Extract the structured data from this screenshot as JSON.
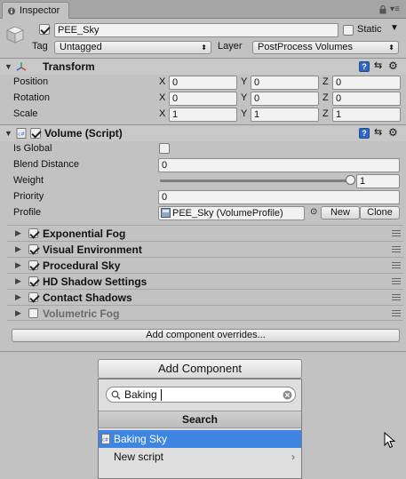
{
  "tab": {
    "label": "Inspector"
  },
  "object": {
    "name": "PEE_Sky",
    "active": true,
    "static_label": "Static",
    "static_checked": false
  },
  "tag": {
    "label": "Tag",
    "value": "Untagged"
  },
  "layer": {
    "label": "Layer",
    "value": "PostProcess Volumes"
  },
  "transform": {
    "title": "Transform",
    "rows": [
      {
        "label": "Position",
        "x": "0",
        "y": "0",
        "z": "0"
      },
      {
        "label": "Rotation",
        "x": "0",
        "y": "0",
        "z": "0"
      },
      {
        "label": "Scale",
        "x": "1",
        "y": "1",
        "z": "1"
      }
    ],
    "axes": [
      "X",
      "Y",
      "Z"
    ]
  },
  "volume": {
    "title": "Volume (Script)",
    "enabled": true,
    "is_global_label": "Is Global",
    "is_global": false,
    "blend_label": "Blend Distance",
    "blend_value": "0",
    "weight_label": "Weight",
    "weight_value": "1",
    "weight_fraction": 1.0,
    "priority_label": "Priority",
    "priority_value": "0",
    "profile_label": "Profile",
    "profile_value": "PEE_Sky (VolumeProfile)",
    "new_label": "New",
    "clone_label": "Clone"
  },
  "overrides": [
    {
      "name": "Exponential Fog",
      "enabled": true
    },
    {
      "name": "Visual Environment",
      "enabled": true
    },
    {
      "name": "Procedural Sky",
      "enabled": true
    },
    {
      "name": "HD Shadow Settings",
      "enabled": true
    },
    {
      "name": "Contact Shadows",
      "enabled": true
    },
    {
      "name": "Volumetric Fog",
      "enabled": false
    }
  ],
  "add_overrides_label": "Add component overrides...",
  "add_component_label": "Add Component",
  "popup": {
    "search_value": "Baking",
    "title": "Search",
    "results": [
      {
        "label": "Baking Sky",
        "selected": true
      },
      {
        "label": "New script",
        "selected": false
      }
    ]
  },
  "colors": {
    "selection": "#3d85e0",
    "background": "#c2c2c2"
  }
}
